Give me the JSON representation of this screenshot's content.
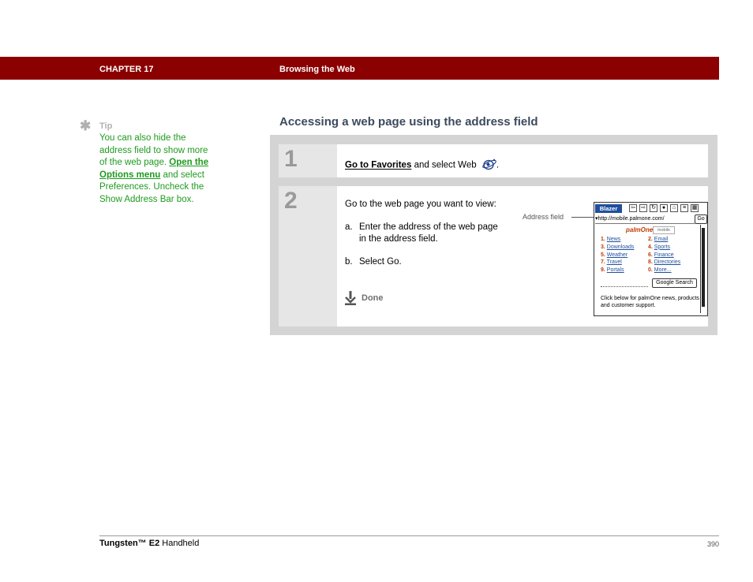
{
  "header": {
    "chapter": "CHAPTER 17",
    "section": "Browsing the Web",
    "bar_color": "#8b0000"
  },
  "tip": {
    "icon": "asterisk-icon",
    "label": "Tip",
    "text_before": "You can also hide the address field to show more of the web page.",
    "link": "Open the Options menu",
    "text_after": "and select Preferences. Uncheck the Show Address Bar box.",
    "color": "#1e9b1e"
  },
  "heading": "Accessing a web page using the address field",
  "steps": [
    {
      "number": "1",
      "link": "Go to Favorites",
      "text": "and select Web",
      "icon": "web-browser-icon",
      "trailing": "."
    },
    {
      "number": "2",
      "intro": "Go to the web page you want to view:",
      "items": [
        {
          "marker": "a.",
          "text": "Enter the address of the web page in the address field."
        },
        {
          "marker": "b.",
          "text": "Select Go."
        }
      ],
      "done": "Done",
      "callout": "Address field"
    }
  ],
  "screenshot": {
    "app_name": "Blazer",
    "url": "http://mobile.palmone.com/",
    "go_label": "Go",
    "logo": "palmOne",
    "mobile_tag": "mobile",
    "links": [
      [
        "1.",
        "News",
        "2.",
        "Email"
      ],
      [
        "3.",
        "Downloads",
        "4.",
        "Sports"
      ],
      [
        "5.",
        "Weather",
        "6.",
        "Finance"
      ],
      [
        "7.",
        "Travel",
        "8.",
        "Directories"
      ],
      [
        "9.",
        "Portals",
        "0.",
        "More..."
      ]
    ],
    "search_button": "Google Search",
    "footer_text": "Click below for palmOne news, products and customer support."
  },
  "footer": {
    "product_bold": "Tungsten™ E2",
    "product_rest": " Handheld",
    "page": "390"
  }
}
